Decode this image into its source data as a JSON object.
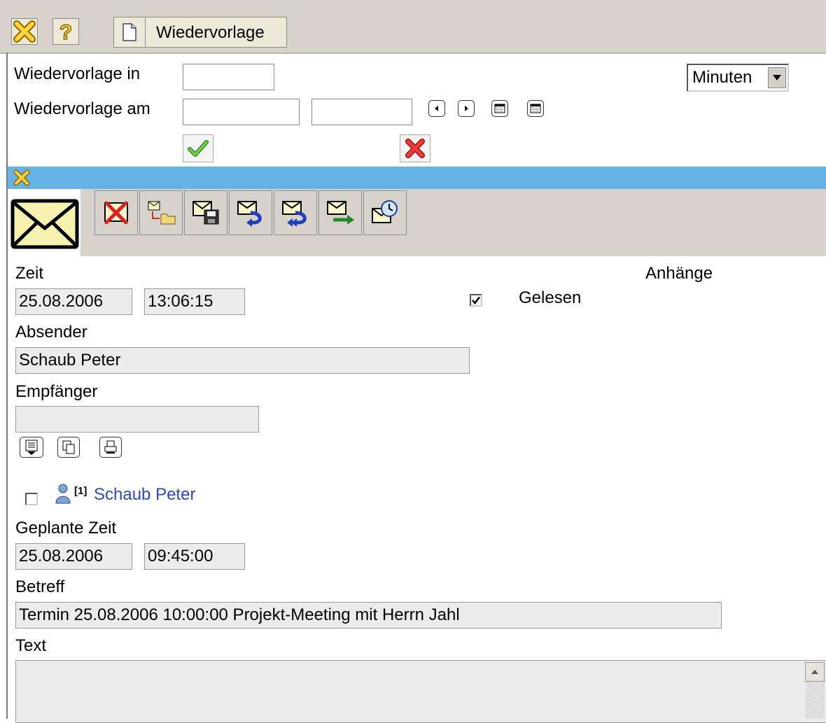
{
  "toolbar": {
    "tab_label": "Wiedervorlage",
    "buttons": {
      "close": "close-icon",
      "help": "help-icon",
      "document": "document-icon"
    }
  },
  "reminder": {
    "in_label": "Wiedervorlage in",
    "in_value": "",
    "unit_selected": "Minuten",
    "am_label": "Wiedervorlage am",
    "date_value": "",
    "time_value": ""
  },
  "message": {
    "zeit_label": "Zeit",
    "date": "25.08.2006",
    "time": "13:06:15",
    "gelesen_label": "Gelesen",
    "gelesen_checked": true,
    "anhaenge_label": "Anhänge",
    "absender_label": "Absender",
    "absender": "Schaub Peter",
    "empfaenger_label": "Empfänger",
    "empfaenger": "",
    "recipient_list": [
      {
        "index": "[1]",
        "name": "Schaub Peter",
        "checked": false
      }
    ],
    "geplante_zeit_label": "Geplante Zeit",
    "planned_date": "25.08.2006",
    "planned_time": "09:45:00",
    "betreff_label": "Betreff",
    "betreff": "Termin 25.08.2006 10:00:00 Projekt-Meeting mit Herrn Jahl",
    "text_label": "Text",
    "text": ""
  },
  "colors": {
    "toolbar_bg": "#d7d3cb",
    "blue_bar": "#66b3e8",
    "link": "#3343c8",
    "readonly_bg": "#ececec"
  }
}
